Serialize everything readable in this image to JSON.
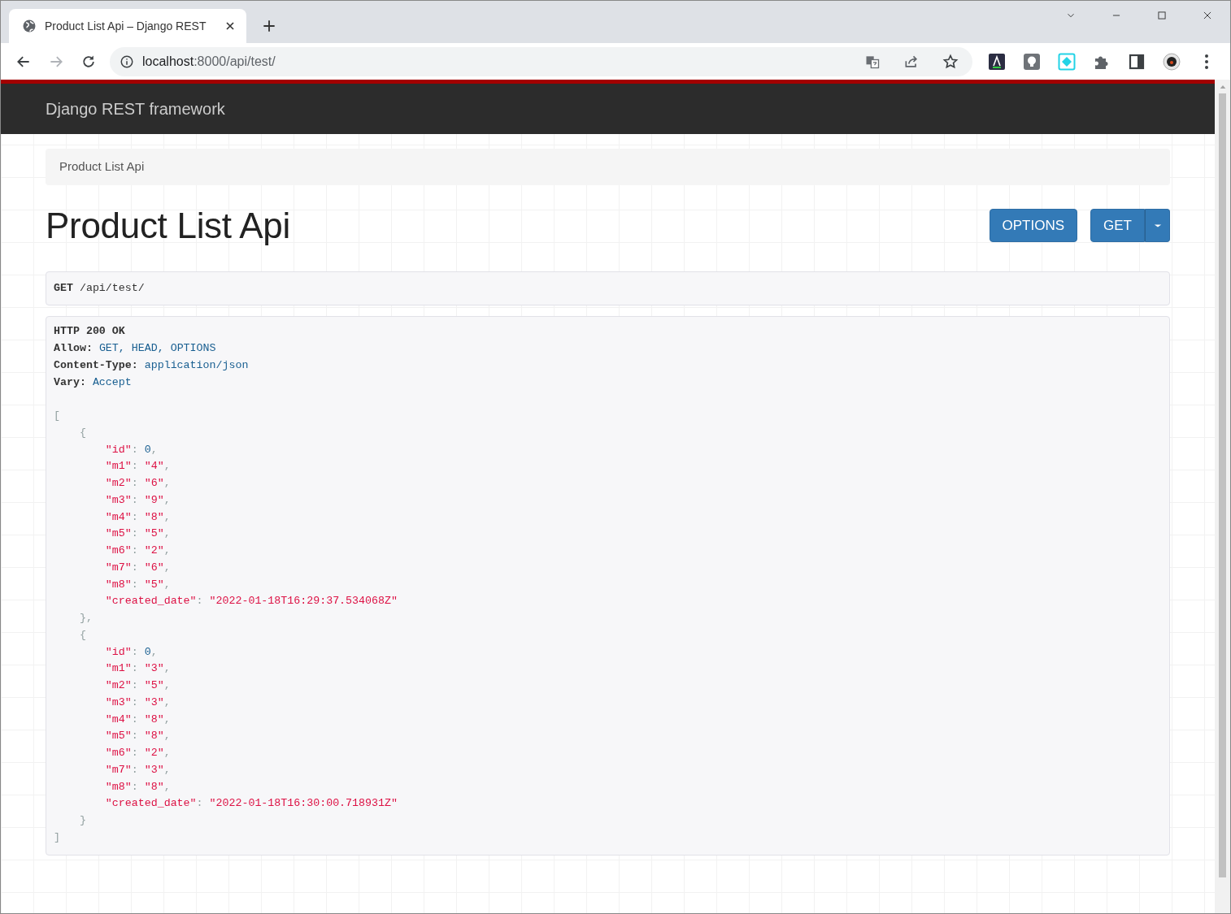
{
  "browser": {
    "tab": {
      "title": "Product List Api – Django REST",
      "selected": true
    },
    "nav_buttons": [
      {
        "kind": "back",
        "disabled": false
      },
      {
        "kind": "forward",
        "disabled": true
      },
      {
        "kind": "reload",
        "disabled": false
      }
    ],
    "address": {
      "host": "localhost",
      "rest": ":8000/api/test/"
    },
    "address_icons": [
      {
        "kind": "translate"
      },
      {
        "kind": "share"
      },
      {
        "kind": "star"
      }
    ],
    "extensions": [
      {
        "kind": "dark-letter"
      },
      {
        "kind": "bulb"
      },
      {
        "kind": "diamond"
      },
      {
        "kind": "puzzle"
      },
      {
        "kind": "sidepanel"
      },
      {
        "kind": "avatar"
      },
      {
        "kind": "menu"
      }
    ]
  },
  "page": {
    "brand": "Django REST framework",
    "breadcrumb": [
      {
        "label": "Product List Api",
        "active": true
      }
    ],
    "title": "Product List Api",
    "buttons": [
      {
        "label": "OPTIONS",
        "dropdown": false
      },
      {
        "label": "GET",
        "dropdown": true
      }
    ],
    "request": {
      "method": "GET",
      "path": "/api/test/"
    },
    "response": {
      "status": "HTTP 200 OK",
      "headers": [
        {
          "name": "Allow:",
          "value": "GET, HEAD, OPTIONS"
        },
        {
          "name": "Content-Type:",
          "value": "application/json"
        },
        {
          "name": "Vary:",
          "value": "Accept"
        }
      ],
      "body": {
        "open": "[",
        "close": "]",
        "items": [
          {
            "open": "{",
            "close": "},",
            "fields": [
              {
                "key": "\"id\"",
                "colon": ":",
                "value": "0",
                "kind": "number",
                "comma": ","
              },
              {
                "key": "\"m1\"",
                "colon": ":",
                "value": "\"4\"",
                "kind": "string",
                "comma": ","
              },
              {
                "key": "\"m2\"",
                "colon": ":",
                "value": "\"6\"",
                "kind": "string",
                "comma": ","
              },
              {
                "key": "\"m3\"",
                "colon": ":",
                "value": "\"9\"",
                "kind": "string",
                "comma": ","
              },
              {
                "key": "\"m4\"",
                "colon": ":",
                "value": "\"8\"",
                "kind": "string",
                "comma": ","
              },
              {
                "key": "\"m5\"",
                "colon": ":",
                "value": "\"5\"",
                "kind": "string",
                "comma": ","
              },
              {
                "key": "\"m6\"",
                "colon": ":",
                "value": "\"2\"",
                "kind": "string",
                "comma": ","
              },
              {
                "key": "\"m7\"",
                "colon": ":",
                "value": "\"6\"",
                "kind": "string",
                "comma": ","
              },
              {
                "key": "\"m8\"",
                "colon": ":",
                "value": "\"5\"",
                "kind": "string",
                "comma": ","
              },
              {
                "key": "\"created_date\"",
                "colon": ":",
                "value": "\"2022-01-18T16:29:37.534068Z\"",
                "kind": "string"
              }
            ]
          },
          {
            "open": "{",
            "close": "}",
            "fields": [
              {
                "key": "\"id\"",
                "colon": ":",
                "value": "0",
                "kind": "number",
                "comma": ","
              },
              {
                "key": "\"m1\"",
                "colon": ":",
                "value": "\"3\"",
                "kind": "string",
                "comma": ","
              },
              {
                "key": "\"m2\"",
                "colon": ":",
                "value": "\"5\"",
                "kind": "string",
                "comma": ","
              },
              {
                "key": "\"m3\"",
                "colon": ":",
                "value": "\"3\"",
                "kind": "string",
                "comma": ","
              },
              {
                "key": "\"m4\"",
                "colon": ":",
                "value": "\"8\"",
                "kind": "string",
                "comma": ","
              },
              {
                "key": "\"m5\"",
                "colon": ":",
                "value": "\"8\"",
                "kind": "string",
                "comma": ","
              },
              {
                "key": "\"m6\"",
                "colon": ":",
                "value": "\"2\"",
                "kind": "string",
                "comma": ","
              },
              {
                "key": "\"m7\"",
                "colon": ":",
                "value": "\"3\"",
                "kind": "string",
                "comma": ","
              },
              {
                "key": "\"m8\"",
                "colon": ":",
                "value": "\"8\"",
                "kind": "string",
                "comma": ","
              },
              {
                "key": "\"created_date\"",
                "colon": ":",
                "value": "\"2022-01-18T16:30:00.718931Z\"",
                "kind": "string"
              }
            ]
          }
        ]
      }
    }
  }
}
